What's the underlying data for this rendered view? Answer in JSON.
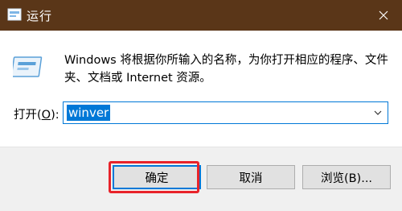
{
  "window": {
    "title": "运行",
    "close_icon": "close-icon"
  },
  "content": {
    "description": "Windows 将根据你所输入的名称，为你打开相应的程序、文件夹、文档或 Internet 资源。",
    "open_label_prefix": "打开(",
    "open_label_key": "O",
    "open_label_suffix": "):",
    "combo_value": "winver"
  },
  "buttons": {
    "ok": "确定",
    "cancel": "取消",
    "browse": "浏览(B)..."
  },
  "colors": {
    "titlebar": "#5a3618",
    "accent": "#0078d7",
    "highlight": "#e8232a"
  }
}
